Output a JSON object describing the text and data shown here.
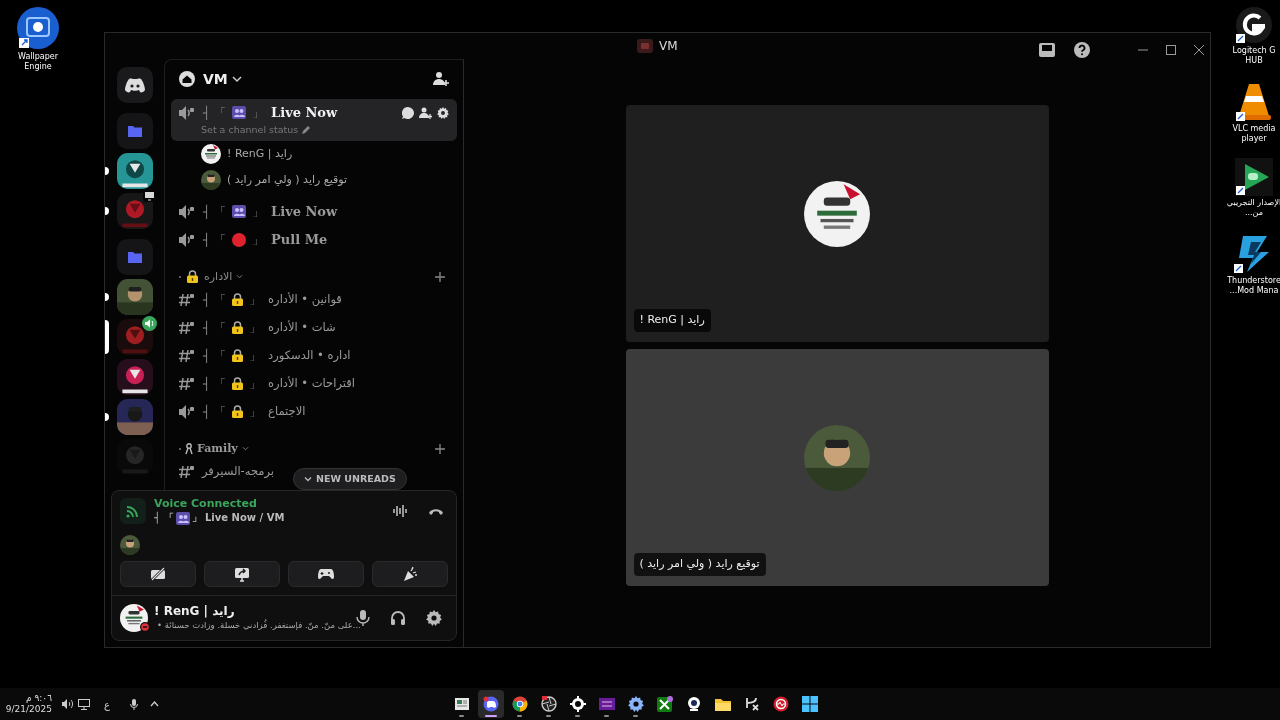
{
  "desktop_left": [
    {
      "kind": "wallpaper",
      "label": "Wallpaper Engine"
    }
  ],
  "desktop_right": [
    {
      "kind": "g-hub",
      "label": "Logitech G HUB"
    },
    {
      "kind": "cone",
      "label": "VLC media player"
    },
    {
      "kind": "play",
      "label": "الإصدار التجريبي من..."
    },
    {
      "kind": "bolt",
      "label": "Thunderstore ...Mod Mana"
    }
  ],
  "window": {
    "title": "VM"
  },
  "server_rail": [
    {
      "kind": "home",
      "selected": false,
      "unread": false
    },
    {
      "kind": "folder",
      "selected": false,
      "unread": false
    },
    {
      "kind": "server",
      "selected": false,
      "unread": true
    },
    {
      "kind": "server",
      "selected": false,
      "unread": true,
      "badge": {
        "kind": "screen"
      }
    },
    {
      "kind": "folder",
      "selected": false,
      "unread": false
    },
    {
      "kind": "server",
      "selected": false,
      "unread": true
    },
    {
      "kind": "server",
      "selected": true,
      "unread": false,
      "badge": {
        "kind": "speaker"
      }
    },
    {
      "kind": "server",
      "selected": false,
      "unread": false
    },
    {
      "kind": "server",
      "selected": false,
      "unread": true
    },
    {
      "kind": "server",
      "selected": false,
      "unread": false
    }
  ],
  "server": {
    "name": "VM"
  },
  "channels": [
    {
      "kind": "voice",
      "prefix": "┤ 「",
      "icon": {
        "kind": "people"
      },
      "close": "」",
      "name": "Live Now",
      "selected": true,
      "status": "Set a channel status",
      "members": [
        {
          "name": "! RenG | رايد"
        },
        {
          "name": "توقيع رايد ( ولي امر رايد )"
        }
      ]
    },
    {
      "kind": "voice",
      "prefix": "┤ 「",
      "icon": {
        "kind": "people"
      },
      "close": "」",
      "name": "Live Now",
      "selected": false
    },
    {
      "kind": "voice",
      "prefix": "┤ 「",
      "icon": {
        "kind": "dot"
      },
      "close": "」",
      "name": "Pull Me",
      "selected": false
    },
    {
      "kind": "category",
      "icon": {
        "kind": "lock"
      },
      "name": "الاداره",
      "children": [
        {
          "kind": "text",
          "prefix": "┤ 「",
          "icon": {
            "kind": "lock"
          },
          "close": "」",
          "name": "قوانين • الأداره"
        },
        {
          "kind": "text",
          "prefix": "┤ 「",
          "icon": {
            "kind": "lock"
          },
          "close": "」",
          "name": "شات • الأداره"
        },
        {
          "kind": "text",
          "prefix": "┤ 「",
          "icon": {
            "kind": "lock"
          },
          "close": "」",
          "name": "اداره • الدسكورد"
        },
        {
          "kind": "text",
          "prefix": "┤ 「",
          "icon": {
            "kind": "lock"
          },
          "close": "」",
          "name": "اقتراحات • الأداره"
        },
        {
          "kind": "voice",
          "prefix": "┤ 「",
          "icon": {
            "kind": "lock"
          },
          "close": "」",
          "name": "الاجتماع"
        }
      ]
    },
    {
      "kind": "category",
      "icon": {
        "kind": "ribbon"
      },
      "name": "Family",
      "children": [
        {
          "kind": "text",
          "name": "برمجه-السيرفر"
        }
      ]
    }
  ],
  "new_unreads": "NEW UNREADS",
  "voice_panel": {
    "status": "Voice Connected",
    "prefix": "┤ 「",
    "icon": {
      "kind": "people"
    },
    "channel": "」 Live Now / VM"
  },
  "user": {
    "name": "! RenG | رايد",
    "status": "...على منّ. منّ. فإستغفر. فُزادني خسلة. وزادت حسنائة •"
  },
  "video_tiles": [
    {
      "label": "! RenG | رايد",
      "highlighted": false
    },
    {
      "label": "توقيع رايد ( ولي امر رايد )",
      "highlighted": true
    }
  ],
  "taskbar": {
    "time": "٩:٠٦ م",
    "date": "9/21/2025",
    "language": "ع",
    "apps": [
      {
        "kind": "widgets",
        "active": false,
        "running": true
      },
      {
        "kind": "chat",
        "active": true,
        "running": true
      },
      {
        "kind": "globe",
        "active": false,
        "running": true
      },
      {
        "kind": "circle",
        "active": false,
        "running": true
      },
      {
        "kind": "steel",
        "active": false,
        "running": true
      },
      {
        "kind": "purple",
        "active": false,
        "running": true
      },
      {
        "kind": "gear",
        "active": false,
        "running": true
      },
      {
        "kind": "green",
        "active": false,
        "running": false
      },
      {
        "kind": "webcam",
        "active": false,
        "running": false
      },
      {
        "kind": "folder",
        "active": false,
        "running": false
      },
      {
        "kind": "vc",
        "active": false,
        "running": false
      },
      {
        "kind": "redring",
        "active": false,
        "running": false
      },
      {
        "kind": "windows",
        "active": false,
        "running": false
      }
    ]
  }
}
